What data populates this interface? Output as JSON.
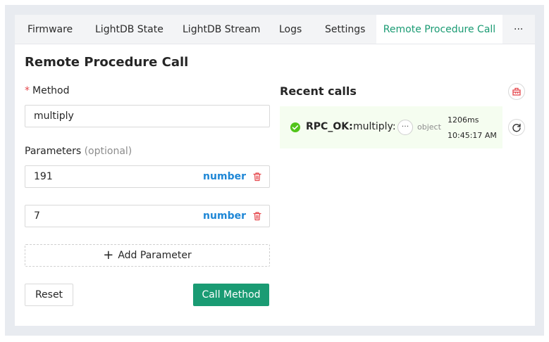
{
  "tabs": [
    {
      "label": "Firmware",
      "active": false
    },
    {
      "label": "LightDB State",
      "active": false
    },
    {
      "label": "LightDB Stream",
      "active": false
    },
    {
      "label": "Logs",
      "active": false
    },
    {
      "label": "Settings",
      "active": false
    },
    {
      "label": "Remote Procedure Call",
      "active": true
    },
    {
      "label": "···",
      "active": false
    }
  ],
  "page_title": "Remote Procedure Call",
  "form": {
    "method_required_mark": "*",
    "method_label": "Method",
    "method_value": "multiply",
    "parameters_label": "Parameters",
    "parameters_optional": "(optional)",
    "parameters": [
      {
        "value": "191",
        "type": "number",
        "delete_icon": "trash-icon"
      },
      {
        "value": "7",
        "type": "number",
        "delete_icon": "trash-icon"
      }
    ],
    "add_parameter_icon": "plus-icon",
    "add_parameter_label": "Add Parameter",
    "reset_label": "Reset",
    "call_label": "Call Method"
  },
  "recent": {
    "title": "Recent calls",
    "clear_icon": "clear-history-icon",
    "rerun_icon": "rerun-icon",
    "calls": [
      {
        "status_icon": "check-circle-icon",
        "status": "RPC_OK:",
        "method": "multiply:",
        "expand_icon": "ellipsis-icon",
        "result_type": "object",
        "duration": "1206ms",
        "time": "10:45:17 AM"
      }
    ]
  },
  "colors": {
    "accent": "#1a9b73",
    "type_tag": "#1f87d6",
    "danger": "#e5484d",
    "success_bg": "#f5fdf0",
    "success_icon": "#52c41a"
  }
}
